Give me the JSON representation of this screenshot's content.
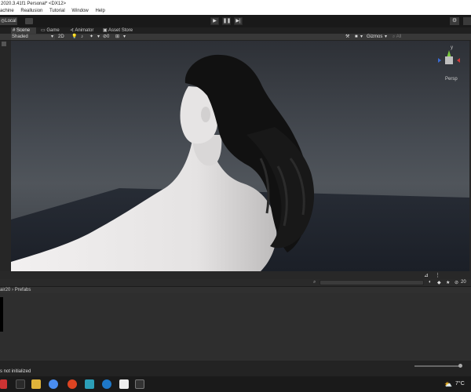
{
  "window": {
    "title": "2020.3.41f1 Personal* <DX12>"
  },
  "menu": {
    "items": [
      "achine",
      "Reallusion",
      "Tutorial",
      "Window",
      "Help"
    ]
  },
  "toolbar": {
    "local_label": "Local",
    "play_icon": "play-icon",
    "pause_icon": "pause-icon",
    "step_icon": "step-icon"
  },
  "tabs": [
    {
      "label": "Scene",
      "active": true
    },
    {
      "label": "Game",
      "active": false
    },
    {
      "label": "Animator",
      "active": false
    },
    {
      "label": "Asset Store",
      "active": false
    }
  ],
  "scene_toolbar": {
    "shading_mode": "Shaded",
    "dimension_toggle": "2D",
    "camera_value": "0",
    "gizmos_label": "Gizmos",
    "search_placeholder": "All"
  },
  "gizmo": {
    "projection_label": "Persp",
    "x_label": "x",
    "y_label": "y",
    "z_label": "z"
  },
  "project": {
    "breadcrumb_root": "air20",
    "breadcrumb_sep": "›",
    "breadcrumb_current": "Prefabs",
    "hidden_count": "20"
  },
  "status": {
    "message": "s not initialized"
  },
  "taskbar": {
    "temperature": "7°C"
  },
  "colors": {
    "chrome_dark": "#1e1e1e",
    "viewport_top": "#2f3238",
    "skin": "#e8e6e6",
    "hair": "#121212",
    "floor": "#1f242c"
  }
}
